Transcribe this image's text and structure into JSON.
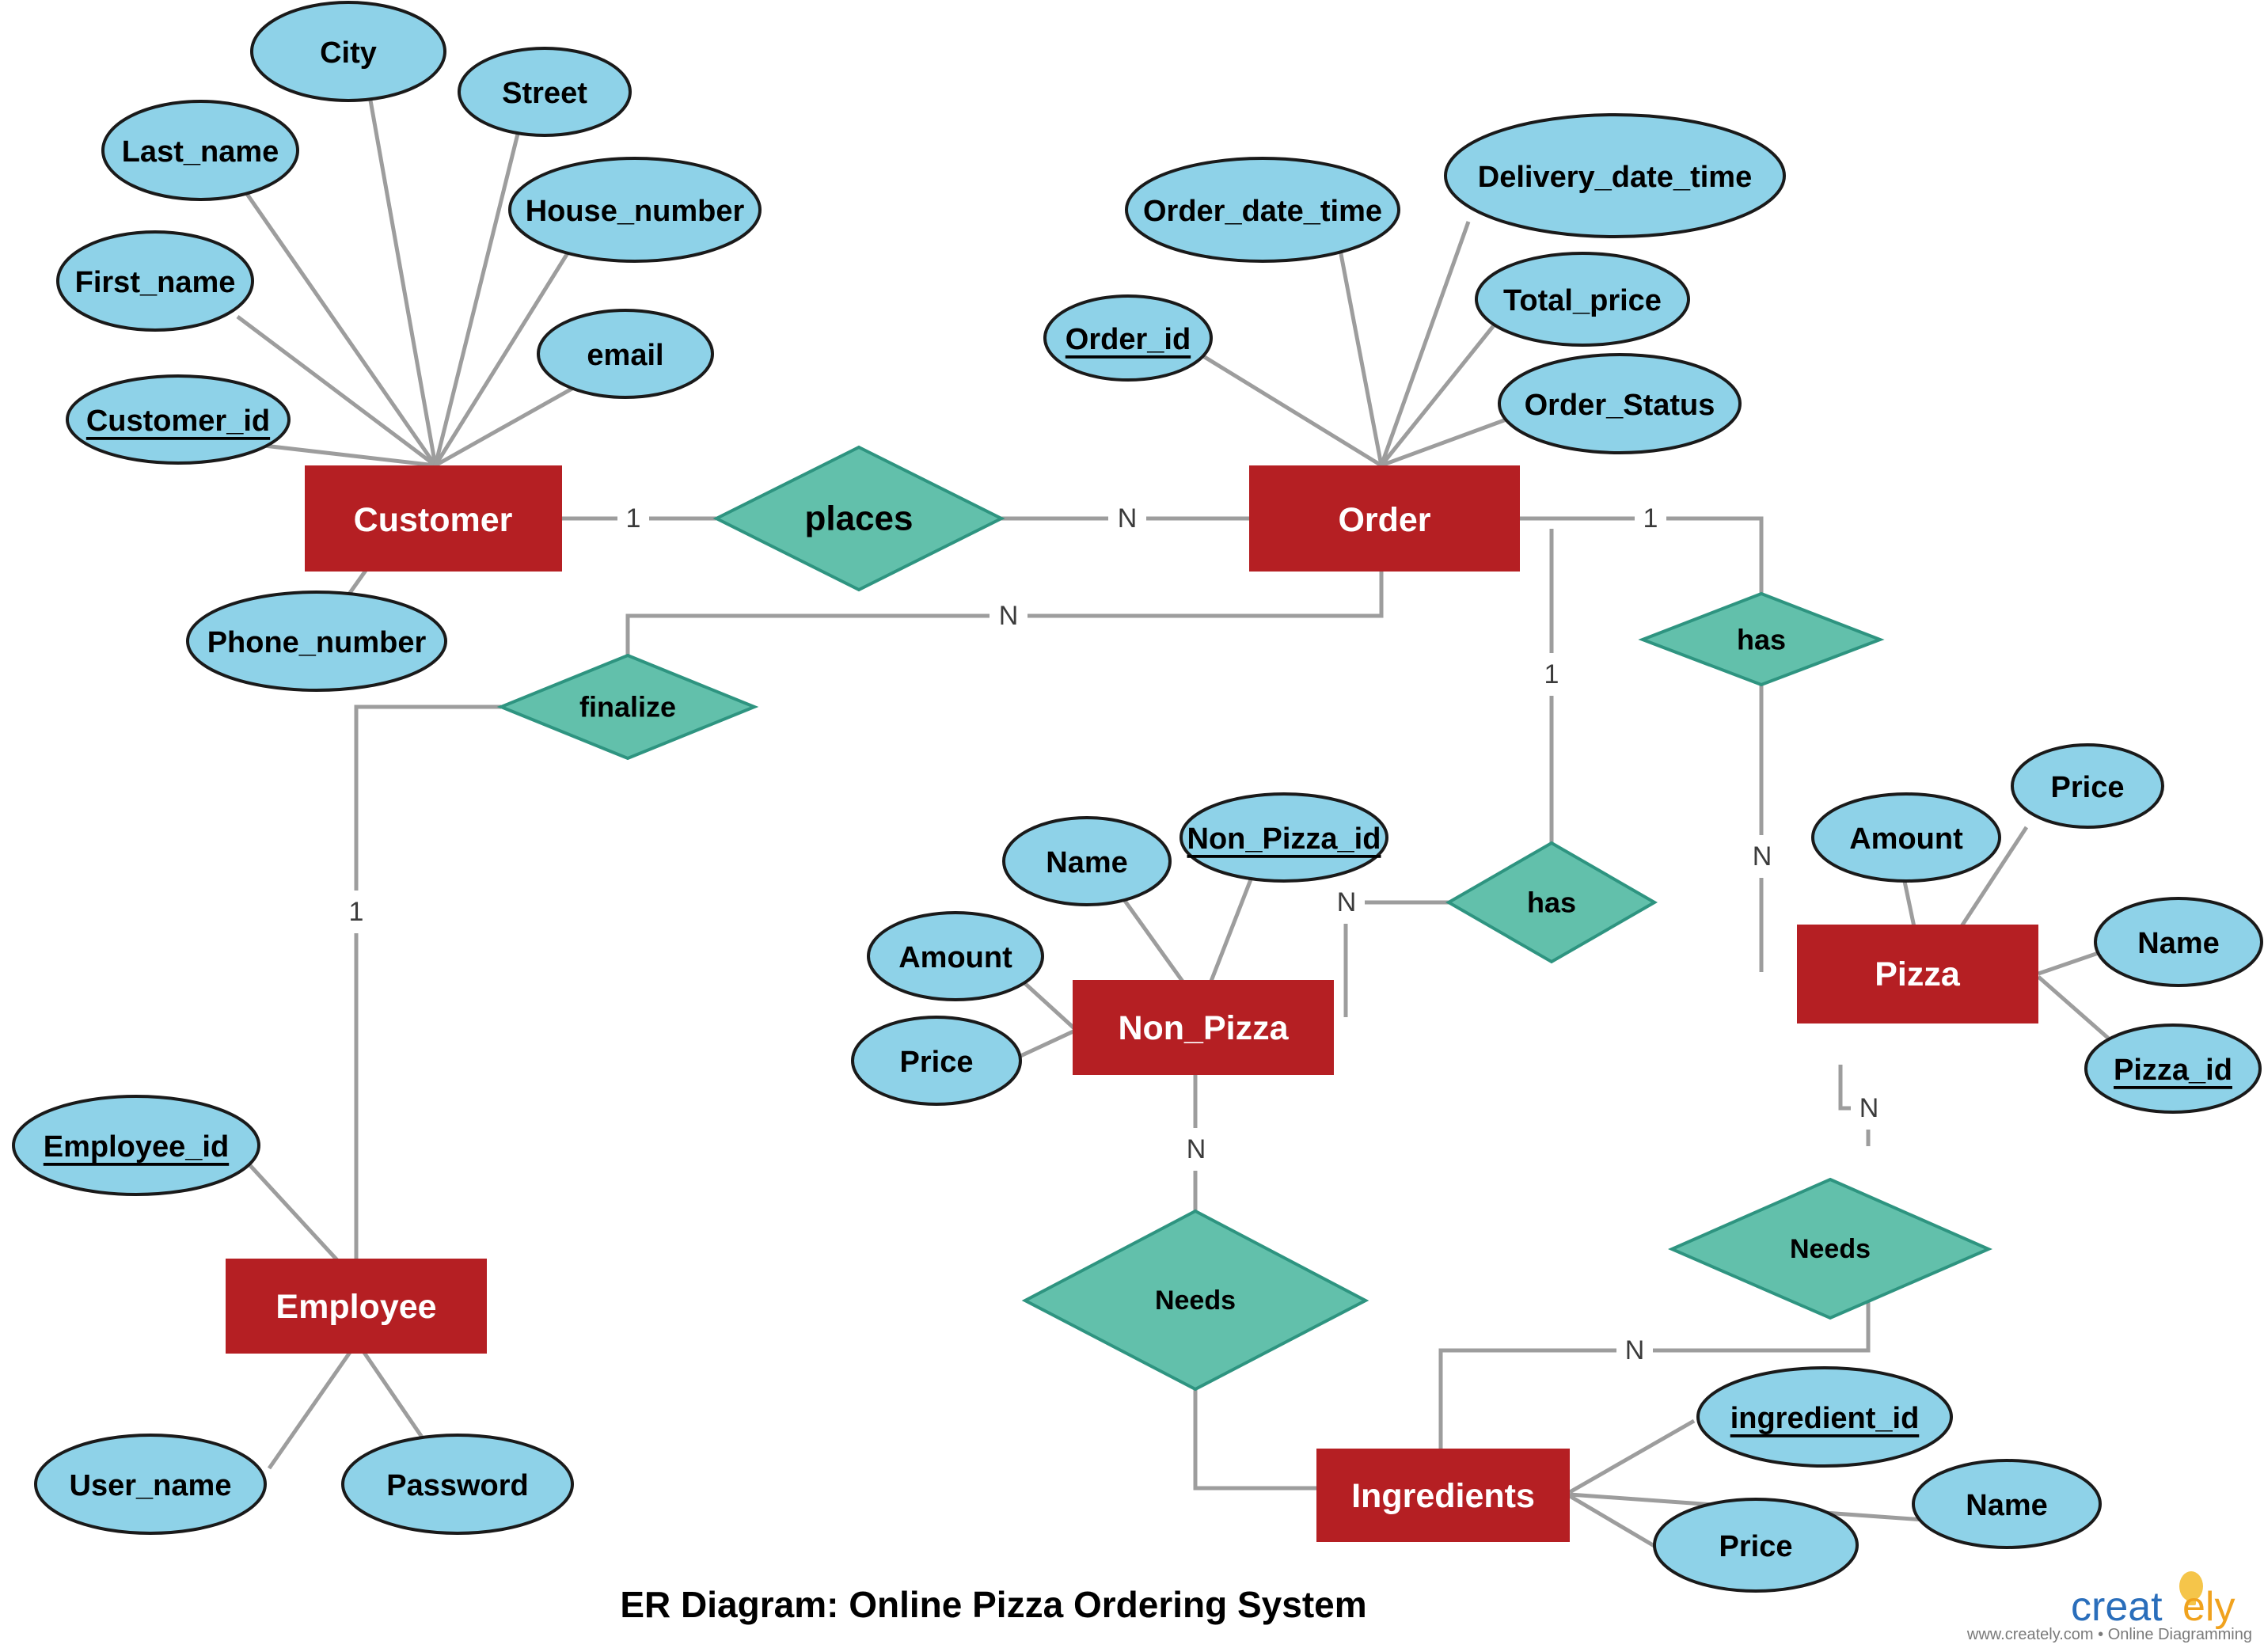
{
  "title": "ER Diagram: Online Pizza Ordering System",
  "watermark": {
    "brand_left": "creat",
    "brand_right": "ely",
    "tagline": "www.creately.com • Online Diagramming",
    "bulb_icon": "lightbulb-icon"
  },
  "colors": {
    "entity_fill": "#b51f23",
    "entity_text": "#ffffff",
    "attribute_fill": "#8ed2e8",
    "attribute_stroke": "#1a1a1a",
    "relationship_fill": "#62c0ab",
    "relationship_stroke": "#2e9480",
    "edge": "#9d9d9d",
    "background": "#ffffff"
  },
  "entities": [
    {
      "id": "customer",
      "label": "Customer"
    },
    {
      "id": "order",
      "label": "Order"
    },
    {
      "id": "employee",
      "label": "Employee"
    },
    {
      "id": "non_pizza",
      "label": "Non_Pizza"
    },
    {
      "id": "pizza",
      "label": "Pizza"
    },
    {
      "id": "ingredients",
      "label": "Ingredients"
    }
  ],
  "attributes": {
    "customer": [
      {
        "label": "City",
        "key": false
      },
      {
        "label": "Street",
        "key": false
      },
      {
        "label": "Last_name",
        "key": false
      },
      {
        "label": "House_number",
        "key": false
      },
      {
        "label": "First_name",
        "key": false
      },
      {
        "label": "email",
        "key": false
      },
      {
        "label": "Customer_id",
        "key": true
      },
      {
        "label": "Phone_number",
        "key": false
      }
    ],
    "order": [
      {
        "label": "Order_date_time",
        "key": false
      },
      {
        "label": "Delivery_date_time",
        "key": false
      },
      {
        "label": "Total_price",
        "key": false
      },
      {
        "label": "Order_id",
        "key": true
      },
      {
        "label": "Order_Status",
        "key": false
      }
    ],
    "employee": [
      {
        "label": "Employee_id",
        "key": true
      },
      {
        "label": "User_name",
        "key": false
      },
      {
        "label": "Password",
        "key": false
      }
    ],
    "non_pizza": [
      {
        "label": "Name",
        "key": false
      },
      {
        "label": "Non_Pizza_id",
        "key": true
      },
      {
        "label": "Amount",
        "key": false
      },
      {
        "label": "Price",
        "key": false
      }
    ],
    "pizza": [
      {
        "label": "Price",
        "key": false
      },
      {
        "label": "Amount",
        "key": false
      },
      {
        "label": "Name",
        "key": false
      },
      {
        "label": "Pizza_id",
        "key": true
      }
    ],
    "ingredients": [
      {
        "label": "ingredient_id",
        "key": true
      },
      {
        "label": "Name",
        "key": false
      },
      {
        "label": "Price",
        "key": false
      }
    ]
  },
  "relationships": [
    {
      "id": "places",
      "label": "places",
      "from": "Customer",
      "to": "Order",
      "from_card": "1",
      "to_card": "N"
    },
    {
      "id": "finalize",
      "label": "finalize",
      "from": "Order",
      "to": "Employee",
      "from_card": "N",
      "to_card": "1"
    },
    {
      "id": "has_pizza",
      "label": "has",
      "from": "Order",
      "to": "Pizza",
      "from_card": "1",
      "to_card": "N"
    },
    {
      "id": "has_nonpizza",
      "label": "has",
      "from": "Order",
      "to": "Non_Pizza",
      "from_card": "1",
      "to_card": "N"
    },
    {
      "id": "needs_left",
      "label": "Needs",
      "from": "Non_Pizza",
      "to": "Ingredients",
      "from_card": "N",
      "to_card": ""
    },
    {
      "id": "needs_right",
      "label": "Needs",
      "from": "Pizza",
      "to": "Ingredients",
      "from_card": "N",
      "to_card": "N"
    }
  ],
  "cardinality_labels": {
    "customer_places": "1",
    "places_order": "N",
    "order_finalize": "N",
    "finalize_employee": "1",
    "order_has_pizza": "1",
    "has_pizza_pizza": "N",
    "order_has_nonpizza": "1",
    "has_nonpizza_nonpizza": "N",
    "nonpizza_needs": "N",
    "pizza_needs": "N",
    "needs_ingredients": "N"
  }
}
